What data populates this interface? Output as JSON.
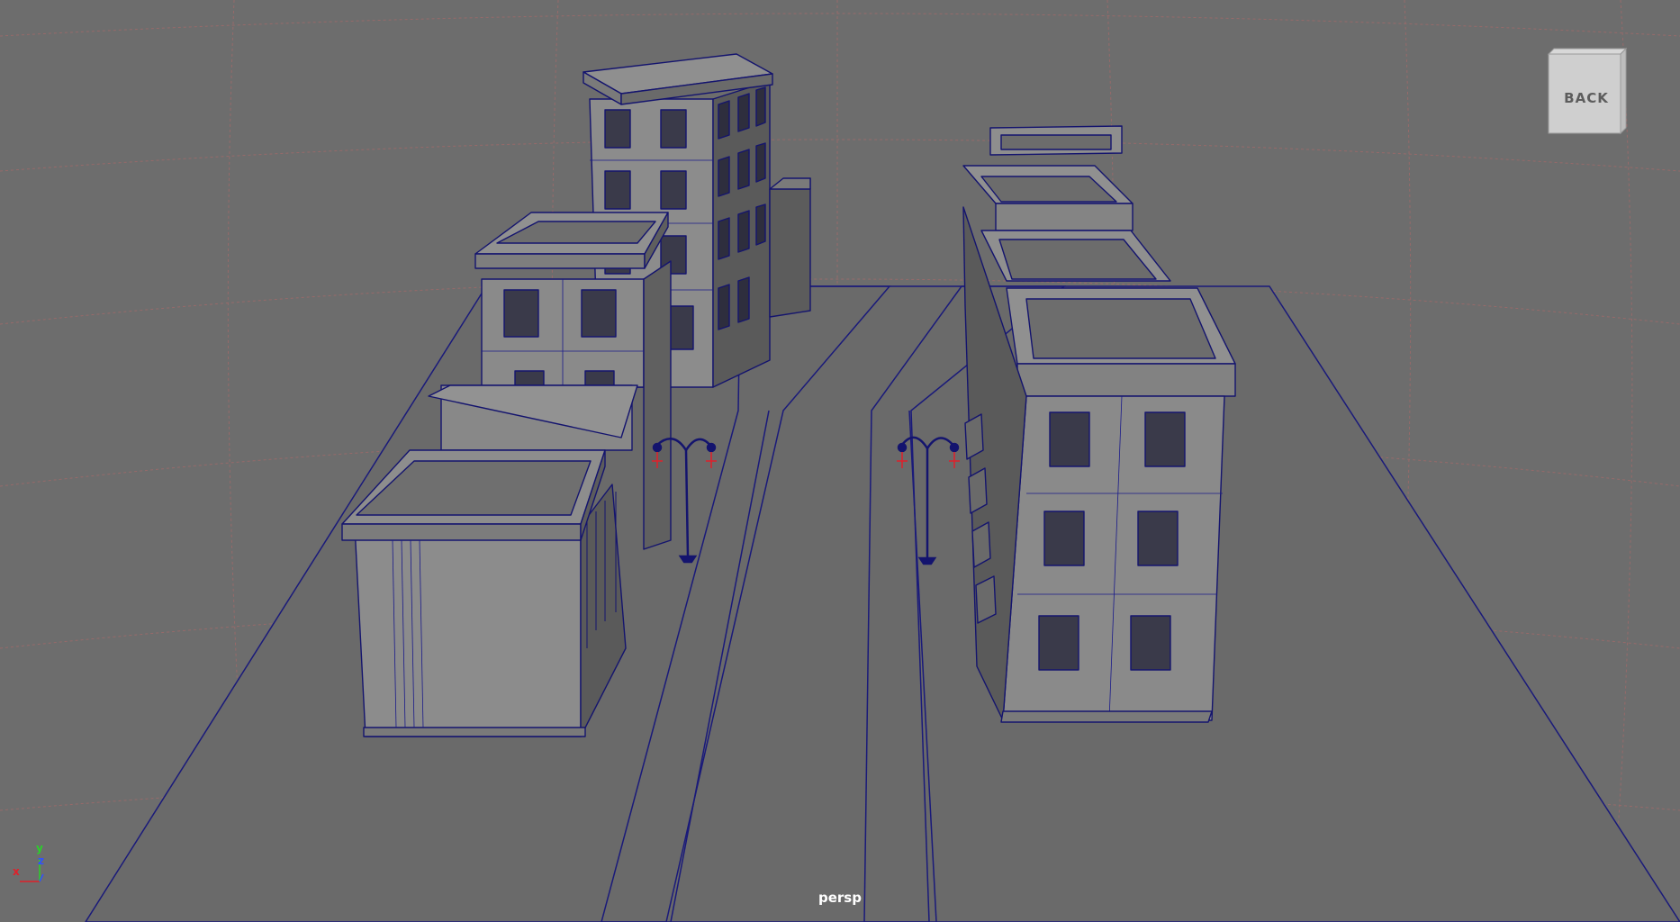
{
  "viewport": {
    "camera_label": "persp",
    "view_cube_label": "BACK",
    "axis_labels": {
      "x": "x",
      "y": "y",
      "z": "z"
    },
    "colors": {
      "background": "#6d6d6d",
      "grid": "#b06a6a",
      "wireframe": "#1a1a8a",
      "surface": "#8a8a8a",
      "x_axis": "#e0202a",
      "y_axis": "#2ad02a",
      "z_axis": "#3050ff"
    }
  }
}
